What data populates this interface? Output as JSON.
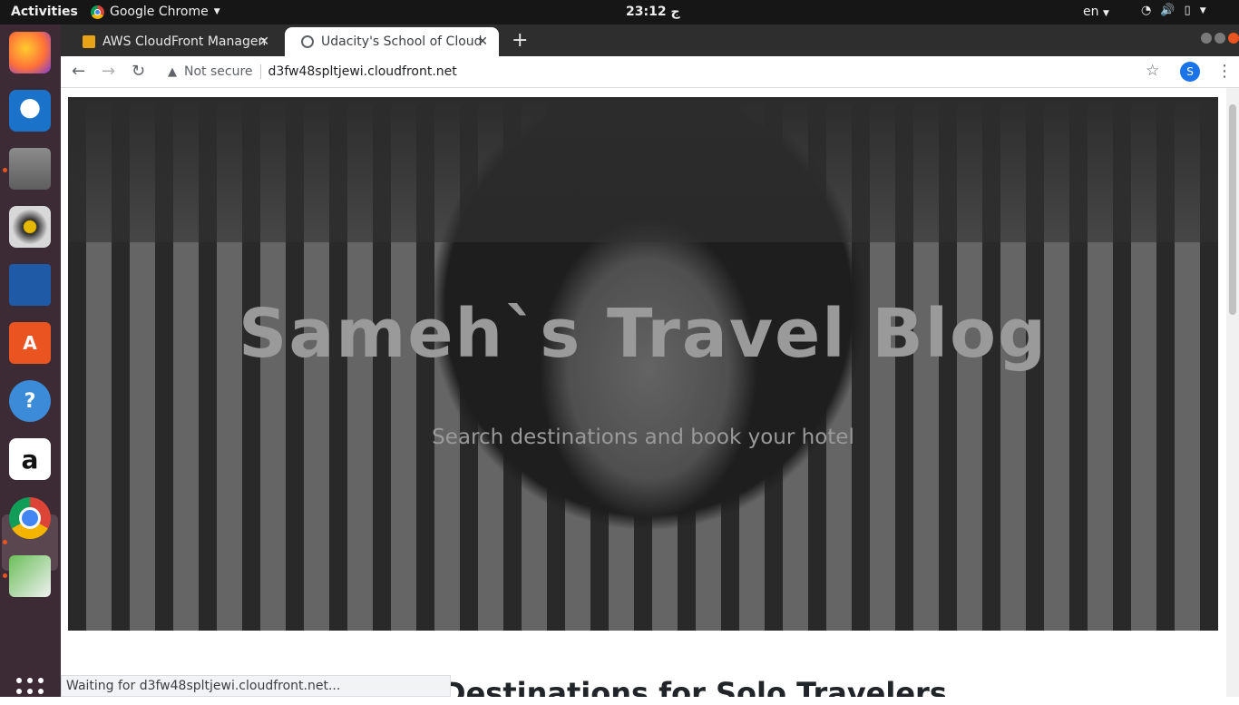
{
  "topbar": {
    "activities": "Activities",
    "app_name": "Google Chrome",
    "clock": "23:12 ج",
    "lang": "en"
  },
  "dock": {
    "apps": [
      "firefox",
      "thunderbird",
      "files",
      "rhythmbox",
      "libreoffice-writer",
      "ubuntu-software",
      "help",
      "amazon",
      "google-chrome",
      "image-viewer"
    ]
  },
  "browser": {
    "tabs": [
      {
        "title": "AWS CloudFront Management Console"
      },
      {
        "title": "Udacity's School of Cloud Computing"
      }
    ],
    "security": "Not secure",
    "url": "d3fw48spltjewi.cloudfront.net",
    "profile_initial": "S"
  },
  "page": {
    "hero_title": "Sameh`s Travel Blog",
    "hero_subtitle": "Search destinations and book your hotel",
    "section_heading": "Destinations for Solo Travelers"
  },
  "status": {
    "text": "Waiting for d3fw48spltjewi.cloudfront.net..."
  },
  "colors": {
    "dock_bg": "#3c2a35",
    "accent": "#e95420",
    "topbar_bg": "#161616",
    "tabstrip_bg": "#2f2e2e"
  }
}
